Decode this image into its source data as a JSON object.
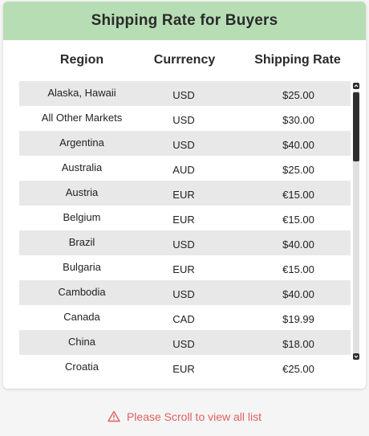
{
  "card": {
    "title": "Shipping Rate for Buyers",
    "columns": {
      "region": "Region",
      "currency": "Currrency",
      "rate": "Shipping Rate"
    },
    "rows": [
      {
        "region": "Alaska, Hawaii",
        "currency": "USD",
        "rate": "$25.00"
      },
      {
        "region": "All Other Markets",
        "currency": "USD",
        "rate": "$30.00"
      },
      {
        "region": "Argentina",
        "currency": "USD",
        "rate": "$40.00"
      },
      {
        "region": "Australia",
        "currency": "AUD",
        "rate": "$25.00"
      },
      {
        "region": "Austria",
        "currency": "EUR",
        "rate": "€15.00"
      },
      {
        "region": "Belgium",
        "currency": "EUR",
        "rate": "€15.00"
      },
      {
        "region": "Brazil",
        "currency": "USD",
        "rate": "$40.00"
      },
      {
        "region": "Bulgaria",
        "currency": "EUR",
        "rate": "€15.00"
      },
      {
        "region": "Cambodia",
        "currency": "USD",
        "rate": "$40.00"
      },
      {
        "region": "Canada",
        "currency": "CAD",
        "rate": "$19.99"
      },
      {
        "region": "China",
        "currency": "USD",
        "rate": "$18.00"
      },
      {
        "region": "Croatia",
        "currency": "EUR",
        "rate": "€25.00"
      }
    ]
  },
  "notice": {
    "text": "Please Scroll to view all list",
    "icon": "warning-triangle-icon"
  },
  "colors": {
    "header_bg": "#b7ddb5",
    "row_alt_bg": "#e8e8e8",
    "notice": "#e06060",
    "scrollbar": "#2e2e2e"
  }
}
